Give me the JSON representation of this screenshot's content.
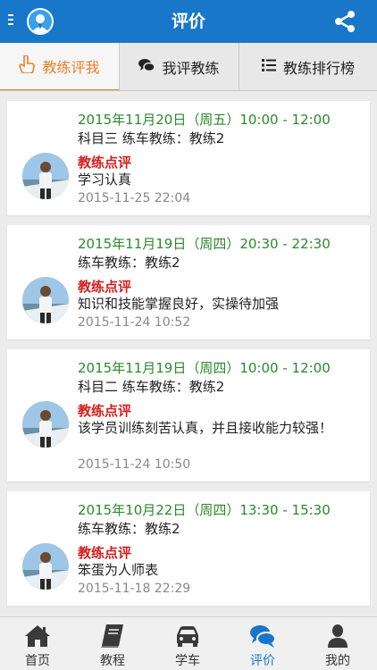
{
  "header": {
    "title": "评价",
    "brand_color": "#1877c8",
    "left_icon": "menu-icon",
    "avatar_icon": "user-avatar-icon",
    "right_icon": "share-icon"
  },
  "tabs": [
    {
      "label": "教练评我",
      "icon": "hand-point-icon",
      "active": true
    },
    {
      "label": "我评教练",
      "icon": "chat-icon",
      "active": false
    },
    {
      "label": "教练排行榜",
      "icon": "list-icon",
      "active": false
    }
  ],
  "reviews": [
    {
      "date": "2015年11月20日（周五）10:00 - 12:00",
      "course": "科目三 练车教练：教练2",
      "label": "教练点评",
      "comment": "学习认真",
      "time": "2015-11-25 22:04"
    },
    {
      "date": "2015年11月19日（周四）20:30 - 22:30",
      "course": "练车教练：教练2",
      "label": "教练点评",
      "comment": "知识和技能掌握良好，实操待加强",
      "time": "2015-11-24 10:52"
    },
    {
      "date": "2015年11月19日（周四）10:00 - 12:00",
      "course": "科目二 练车教练：教练2",
      "label": "教练点评",
      "comment": "该学员训练刻苦认真，并且接收能力较强！",
      "time": "2015-11-24 10:50"
    },
    {
      "date": "2015年10月22日（周四）13:30 - 15:30",
      "course": "练车教练：教练2",
      "label": "教练点评",
      "comment": "笨蛋为人师表",
      "time": "2015-11-18 22:29"
    }
  ],
  "bottom_nav": [
    {
      "label": "首页",
      "icon": "home-icon",
      "active": false
    },
    {
      "label": "教程",
      "icon": "book-icon",
      "active": false
    },
    {
      "label": "学车",
      "icon": "car-icon",
      "active": false
    },
    {
      "label": "评价",
      "icon": "comments-icon",
      "active": true
    },
    {
      "label": "我的",
      "icon": "person-icon",
      "active": false
    }
  ],
  "colors": {
    "date_green": "#2a8a2a",
    "label_red": "#d2201e",
    "active_tab_orange": "#e8802a",
    "nav_active_blue": "#1877c8"
  }
}
